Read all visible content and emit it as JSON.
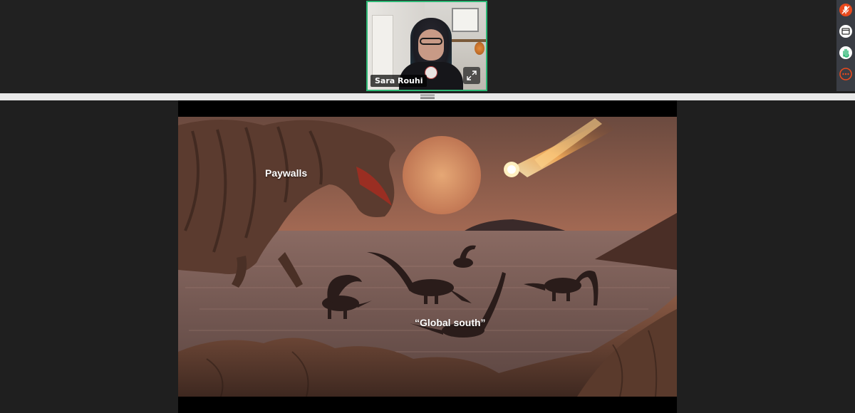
{
  "participant": {
    "name": "Sara Rouhi"
  },
  "icons": {
    "expand": "expand-icon",
    "mic": "microphone-muted-icon",
    "window": "window-icon",
    "hand": "raise-hand-icon",
    "more": "more-options-icon"
  },
  "colors": {
    "active_speaker_border": "#2bb673",
    "mic_muted": "#e8491d",
    "hand_accent": "#2bb673",
    "more_accent": "#e8491d"
  },
  "slide": {
    "label_top": "Paywalls",
    "label_bottom": "“Global south”"
  }
}
